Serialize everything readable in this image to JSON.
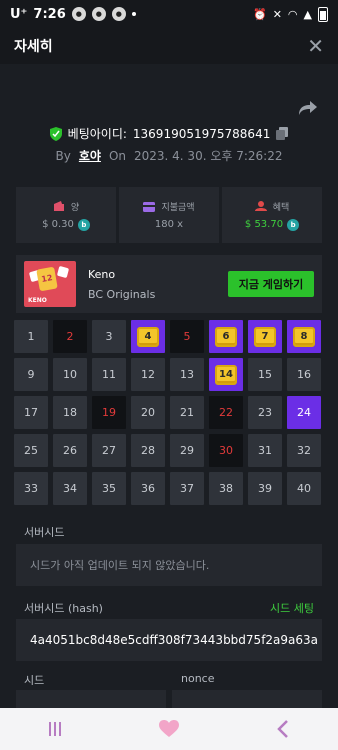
{
  "status": {
    "carrier": "U⁺",
    "time": "7:26"
  },
  "header": {
    "title": "자세히",
    "close_glyph": "✕"
  },
  "bet": {
    "label": "베팅아이디:",
    "id": "136919051975788641"
  },
  "byline": {
    "by": "By",
    "user": "호야",
    "on": "On",
    "datetime": "2023. 4. 30. 오후 7:26:22"
  },
  "stats": [
    {
      "label": "양",
      "value": "$ 0.30",
      "color": "#e0506a"
    },
    {
      "label": "지불금액",
      "value": "180 x",
      "color": "#9b6ae6"
    },
    {
      "label": "혜택",
      "value": "$ 53.70",
      "color": "#e04a4a"
    }
  ],
  "game": {
    "name": "Keno",
    "provider": "BC Originals",
    "play_label": "지금 게임하기",
    "thumb_number": "12",
    "thumb_text": "KENO"
  },
  "grid": [
    {
      "n": "1",
      "state": "normal"
    },
    {
      "n": "2",
      "state": "red"
    },
    {
      "n": "3",
      "state": "normal"
    },
    {
      "n": "4",
      "state": "hit"
    },
    {
      "n": "5",
      "state": "red"
    },
    {
      "n": "6",
      "state": "hit"
    },
    {
      "n": "7",
      "state": "hit"
    },
    {
      "n": "8",
      "state": "hit"
    },
    {
      "n": "9",
      "state": "normal"
    },
    {
      "n": "10",
      "state": "normal"
    },
    {
      "n": "11",
      "state": "normal"
    },
    {
      "n": "12",
      "state": "normal"
    },
    {
      "n": "13",
      "state": "normal"
    },
    {
      "n": "14",
      "state": "hit"
    },
    {
      "n": "15",
      "state": "normal"
    },
    {
      "n": "16",
      "state": "normal"
    },
    {
      "n": "17",
      "state": "normal"
    },
    {
      "n": "18",
      "state": "normal"
    },
    {
      "n": "19",
      "state": "red"
    },
    {
      "n": "20",
      "state": "normal"
    },
    {
      "n": "21",
      "state": "normal"
    },
    {
      "n": "22",
      "state": "red"
    },
    {
      "n": "23",
      "state": "normal"
    },
    {
      "n": "24",
      "state": "selected"
    },
    {
      "n": "25",
      "state": "normal"
    },
    {
      "n": "26",
      "state": "normal"
    },
    {
      "n": "27",
      "state": "normal"
    },
    {
      "n": "28",
      "state": "normal"
    },
    {
      "n": "29",
      "state": "normal"
    },
    {
      "n": "30",
      "state": "red"
    },
    {
      "n": "31",
      "state": "normal"
    },
    {
      "n": "32",
      "state": "normal"
    },
    {
      "n": "33",
      "state": "normal"
    },
    {
      "n": "34",
      "state": "normal"
    },
    {
      "n": "35",
      "state": "normal"
    },
    {
      "n": "36",
      "state": "normal"
    },
    {
      "n": "37",
      "state": "normal"
    },
    {
      "n": "38",
      "state": "normal"
    },
    {
      "n": "39",
      "state": "normal"
    },
    {
      "n": "40",
      "state": "normal"
    }
  ],
  "server_seed": {
    "label": "서버시드",
    "message": "시드가 아직 업데이트 되지 않았습니다."
  },
  "server_seed_hash": {
    "label": "서버시드 (hash)",
    "action": "시드 세팅",
    "value": "4a4051bc8d48e5cdff308f73443bbd75f2a9a63a"
  },
  "seed": {
    "label": "시드"
  },
  "nonce": {
    "label": "nonce"
  },
  "colors": {
    "accent_green": "#2bc12b",
    "hit_purple": "#6b2ee6",
    "gem_yellow": "#f3c52a",
    "miss_red": "#e23a3a"
  }
}
